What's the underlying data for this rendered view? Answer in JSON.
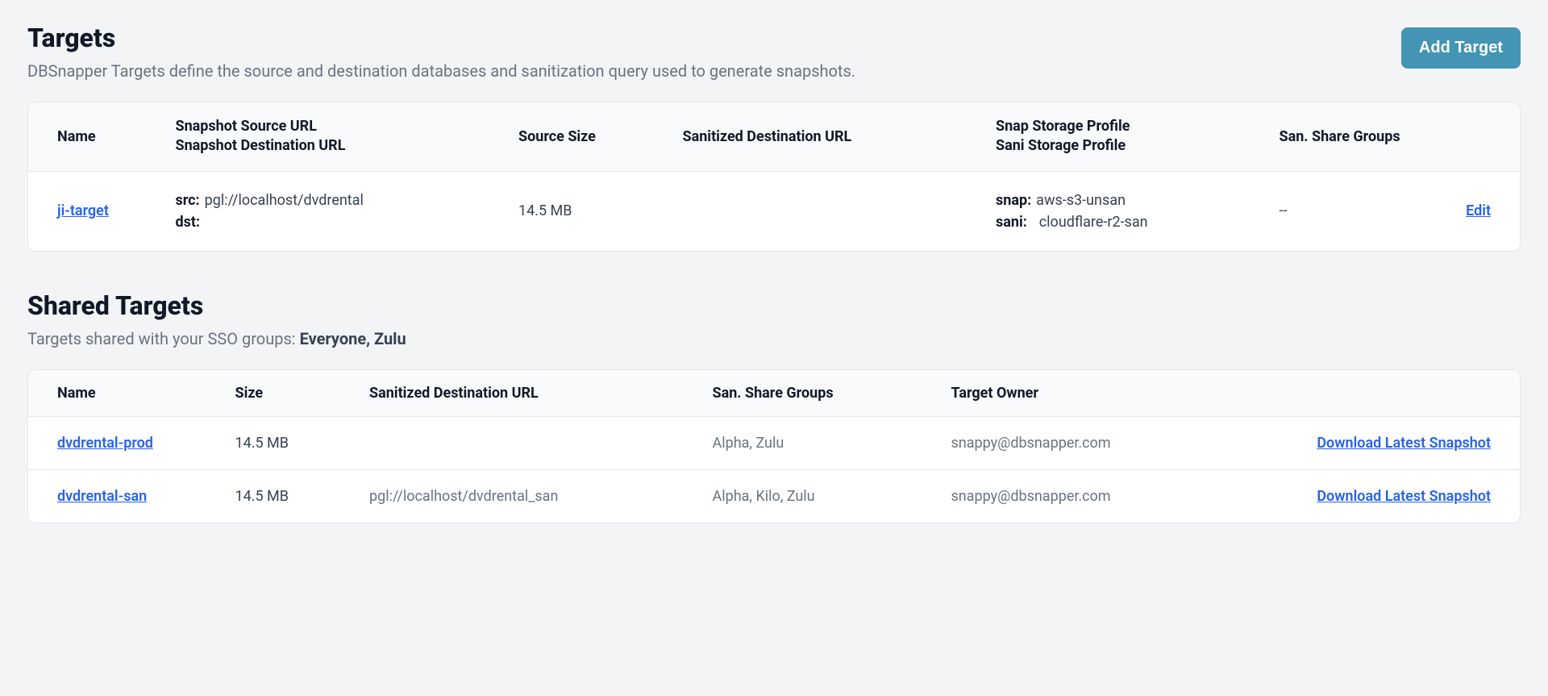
{
  "targets_section": {
    "title": "Targets",
    "subtitle": "DBSnapper Targets define the source and destination databases and sanitization query used to generate snapshots.",
    "add_button_label": "Add Target",
    "columns": {
      "name": "Name",
      "url_line1": "Snapshot Source URL",
      "url_line2": "Snapshot Destination URL",
      "source_size": "Source Size",
      "san_dest_url": "Sanitized Destination URL",
      "storage_line1": "Snap Storage Profile",
      "storage_line2": "Sani Storage Profile",
      "share_groups": "San. Share Groups"
    },
    "rows": [
      {
        "name": "ji-target",
        "src_label": "src:",
        "src_value": "pgl://localhost/dvdrental",
        "dst_label": "dst:",
        "dst_value": "",
        "source_size": "14.5 MB",
        "san_dest_url": "",
        "snap_label": "snap:",
        "snap_value": "aws-s3-unsan",
        "sani_label": "sani:",
        "sani_value": "cloudflare-r2-san",
        "share_groups": "--",
        "edit_label": "Edit"
      }
    ]
  },
  "shared_section": {
    "title": "Shared Targets",
    "subtitle_prefix": "Targets shared with your SSO groups: ",
    "subtitle_groups": "Everyone, Zulu",
    "columns": {
      "name": "Name",
      "size": "Size",
      "san_dest_url": "Sanitized Destination URL",
      "share_groups": "San. Share Groups",
      "owner": "Target Owner"
    },
    "rows": [
      {
        "name": "dvdrental-prod",
        "size": "14.5 MB",
        "san_dest_url": "",
        "share_groups": "Alpha, Zulu",
        "owner": "snappy@dbsnapper.com",
        "download_label": "Download Latest Snapshot"
      },
      {
        "name": "dvdrental-san",
        "size": "14.5 MB",
        "san_dest_url": "pgl://localhost/dvdrental_san",
        "share_groups": "Alpha, Kilo, Zulu",
        "owner": "snappy@dbsnapper.com",
        "download_label": "Download Latest Snapshot"
      }
    ]
  }
}
